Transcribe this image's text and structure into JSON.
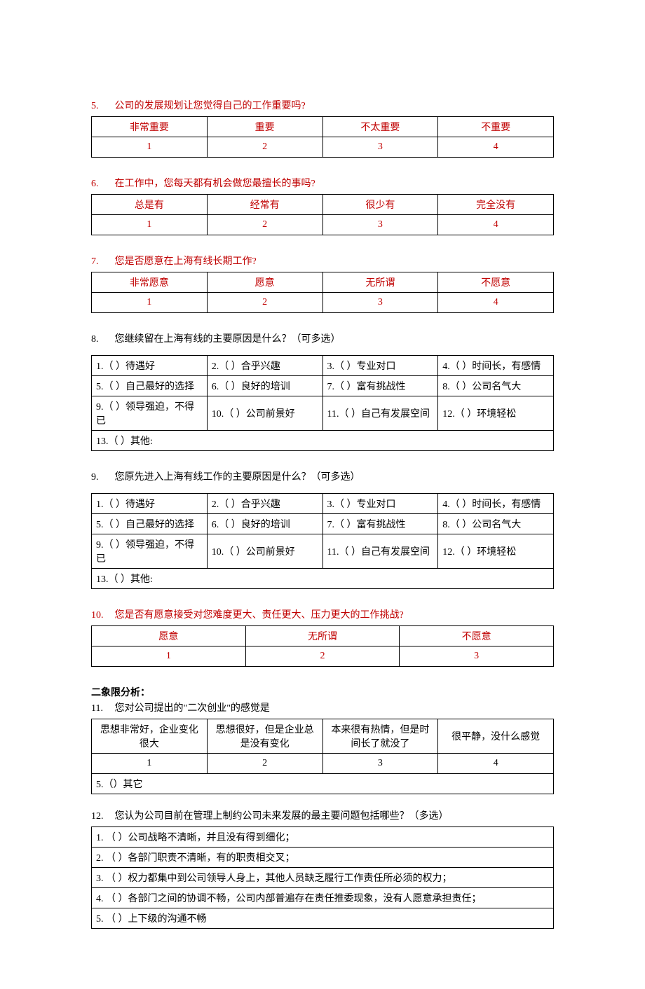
{
  "q5": {
    "num": "5.",
    "text": "公司的发展规划让您觉得自己的工作重要吗?",
    "headers": [
      "非常重要",
      "重要",
      "不太重要",
      "不重要"
    ],
    "values": [
      "1",
      "2",
      "3",
      "4"
    ]
  },
  "q6": {
    "num": "6.",
    "text": "在工作中，您每天都有机会做您最擅长的事吗?",
    "headers": [
      "总是有",
      "经常有",
      "很少有",
      "完全没有"
    ],
    "values": [
      "1",
      "2",
      "3",
      "4"
    ]
  },
  "q7": {
    "num": "7.",
    "text": "您是否愿意在上海有线长期工作?",
    "headers": [
      "非常愿意",
      "愿意",
      "无所谓",
      "不愿意"
    ],
    "values": [
      "1",
      "2",
      "3",
      "4"
    ]
  },
  "q8": {
    "num": "8.",
    "text": "您继续留在上海有线的主要原因是什么？（可多选）",
    "rows": [
      [
        "1.（  ）待遇好",
        "2.（  ）合乎兴趣",
        "3.（  ）专业对口",
        "4.（  ）时间长，有感情"
      ],
      [
        "5.（  ）自己最好的选择",
        "6.（  ）良好的培训",
        "7.（  ）富有挑战性",
        "8.（  ）公司名气大"
      ],
      [
        "9.（  ）领导强迫，不得已",
        "10.（  ）公司前景好",
        "11.（  ）自己有发展空间",
        "12.（  ）环境轻松"
      ]
    ],
    "last": "13.（  ）其他:"
  },
  "q9": {
    "num": "9.",
    "text": "您原先进入上海有线工作的主要原因是什么？（可多选）",
    "rows": [
      [
        "1.（  ）待遇好",
        "2.（  ）合乎兴趣",
        "3.（  ）专业对口",
        "4.（  ）时间长，有感情"
      ],
      [
        "5.（  ）自己最好的选择",
        "6.（  ）良好的培训",
        "7.（  ）富有挑战性",
        "8.（  ）公司名气大"
      ],
      [
        "9.（  ）领导强迫，不得已",
        "10.（  ）公司前景好",
        "11.（  ）自己有发展空间",
        "12.（  ）环境轻松"
      ]
    ],
    "last": "13.（  ）其他:"
  },
  "q10": {
    "num": "10.",
    "text": "您是否有愿意接受对您难度更大、责任更大、压力更大的工作挑战?",
    "headers": [
      "愿意",
      "无所谓",
      "不愿意"
    ],
    "values": [
      "1",
      "2",
      "3"
    ]
  },
  "section2": "二象限分析：",
  "q11": {
    "num": "11.",
    "text": "您对公司提出的\"二次创业\"的感觉是",
    "headers": [
      "思想非常好，企业变化很大",
      "思想很好，但是企业总是没有变化",
      "本来很有热情，但是时间长了就没了",
      "很平静，没什么感觉"
    ],
    "values": [
      "1",
      "2",
      "3",
      "4"
    ],
    "last": "5.（）其它"
  },
  "q12": {
    "num": "12.",
    "text": "您认为公司目前在管理上制约公司未来发展的最主要问题包括哪些？（多选）",
    "items": [
      "1. （  ）公司战略不清晰，并且没有得到细化；",
      "2. （  ）各部门职责不清晰，有的职责相交叉；",
      "3. （  ）权力都集中到公司领导人身上，其他人员缺乏履行工作责任所必须的权力；",
      "4. （  ）各部门之间的协调不畅，公司内部普遍存在责任推委现象，没有人愿意承担责任；",
      "5. （  ）上下级的沟通不畅"
    ]
  }
}
